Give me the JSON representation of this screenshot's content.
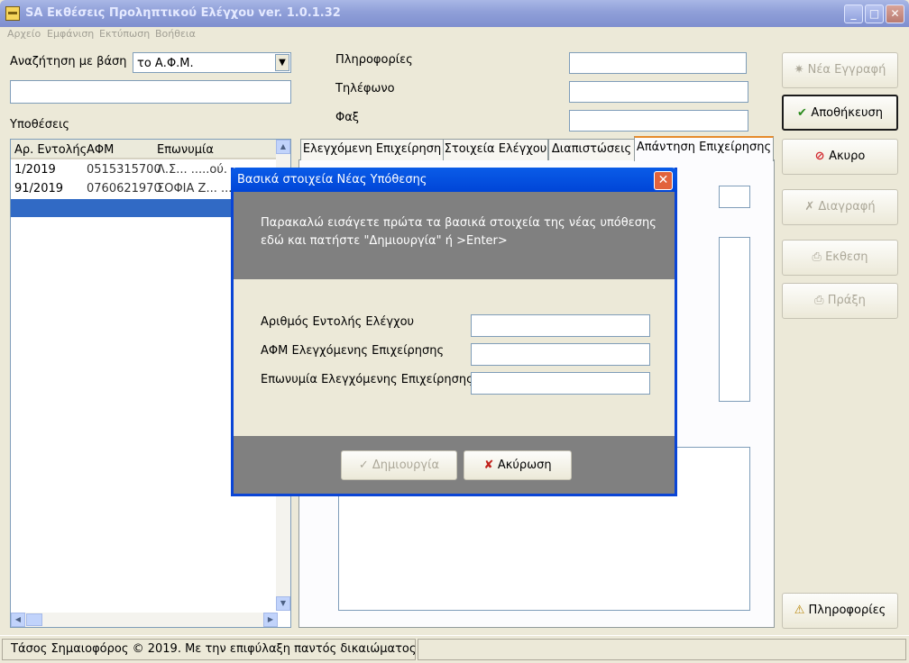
{
  "window": {
    "title": "SA Εκθέσεις Προληπτικού Ελέγχου ver. 1.0.1.32",
    "controls": {
      "minimize": "_",
      "maximize": "□",
      "close": "✕"
    }
  },
  "menu": [
    "Αρχείο",
    "Εμφάνιση",
    "Εκτύπωση",
    "Βοήθεια"
  ],
  "search": {
    "label": "Αναζήτηση με βάση",
    "selected": "το Α.Φ.Μ.",
    "value": ""
  },
  "cases": {
    "label": "Υποθέσεις",
    "columns": [
      "Αρ. Εντολής",
      "ΑΦΜ",
      "Επωνυμία"
    ],
    "rows": [
      {
        "entoli": "1/2019",
        "afm": "0515315700",
        "name": "Λ.Σ... .....ού."
      },
      {
        "entoli": "91/2019",
        "afm": "0760621970",
        "name": "ΣΟΦΙΑ Ζ... ..."
      }
    ]
  },
  "info": {
    "info_label": "Πληροφορίες",
    "phone_label": "Τηλέφωνο",
    "fax_label": "Φαξ"
  },
  "tabs": [
    "Ελεγχόμενη Επιχείρηση",
    "Στοιχεία Ελέγχου",
    "Διαπιστώσεις",
    "Απάντηση Επιχείρησης"
  ],
  "buttons": {
    "new": "Νέα Εγγραφή",
    "save": "Αποθήκευση",
    "cancel": "Ακυρο",
    "delete": "Διαγραφή",
    "report": "Εκθεση",
    "act": "Πράξη",
    "info": "Πληροφορίες"
  },
  "status": {
    "text": "Τάσος Σημαιοφόρος © 2019. Με την επιφύλαξη παντός δικαιώματος"
  },
  "dialog": {
    "title": "Βασικά στοιχεία Νέας Υπόθεσης",
    "message": "Παρακαλώ εισάγετε πρώτα τα βασικά στοιχεία της νέας υπόθεσης εδώ και πατήστε \"Δημιουργία\" ή >Enter>",
    "fields": {
      "order_label": "Αριθμός Εντολής Ελέγχου",
      "afm_label": "ΑΦΜ Ελεγχόμενης Επιχείρησης",
      "name_label": "Επωνυμία Ελεγχόμενης Επιχείρησης"
    },
    "create_button": "Δημιουργία",
    "cancel_button": "Ακύρωση"
  },
  "colors": {
    "dialog_border": "#0a45d6",
    "dialog_panel": "#808080",
    "selection": "#316ac5",
    "tab_highlight": "#e68b2c"
  }
}
